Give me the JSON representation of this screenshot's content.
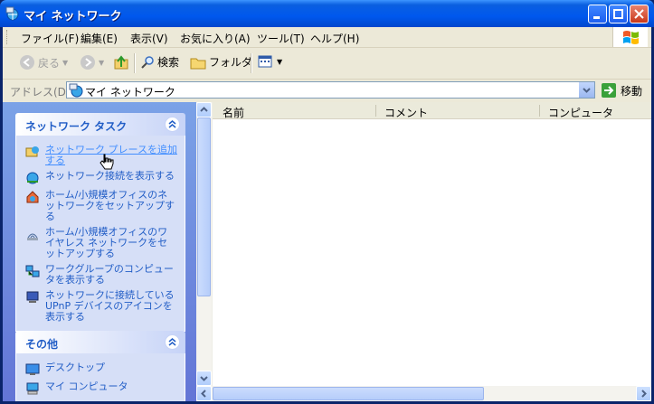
{
  "window": {
    "title": "マイ ネットワーク"
  },
  "menu": [
    "ファイル(F)",
    "編集(E)",
    "表示(V)",
    "お気に入り(A)",
    "ツール(T)",
    "ヘルプ(H)"
  ],
  "toolbar": {
    "back": "戻る",
    "search": "検索",
    "folders": "フォルダ"
  },
  "address": {
    "label": "アドレス(D)",
    "value": "マイ ネットワーク",
    "go": "移動"
  },
  "panels": {
    "network_tasks": {
      "title": "ネットワーク タスク",
      "items": [
        "ネットワーク プレースを追加する",
        "ネットワーク接続を表示する",
        "ホーム/小規模オフィスのネットワークをセットアップする",
        "ホーム/小規模オフィスのワイヤレス ネットワークをセットアップする",
        "ワークグループのコンピュータを表示する",
        "ネットワークに接続している UPnP デバイスのアイコンを表示する"
      ]
    },
    "other": {
      "title": "その他",
      "items": [
        "デスクトップ",
        "マイ コンピュータ"
      ]
    }
  },
  "columns": [
    "名前",
    "コメント",
    "コンピュータ"
  ],
  "colors": {
    "titlebar": "#0058ee",
    "task_link": "#215dc6",
    "pane_bg": "#7ba2e7"
  }
}
